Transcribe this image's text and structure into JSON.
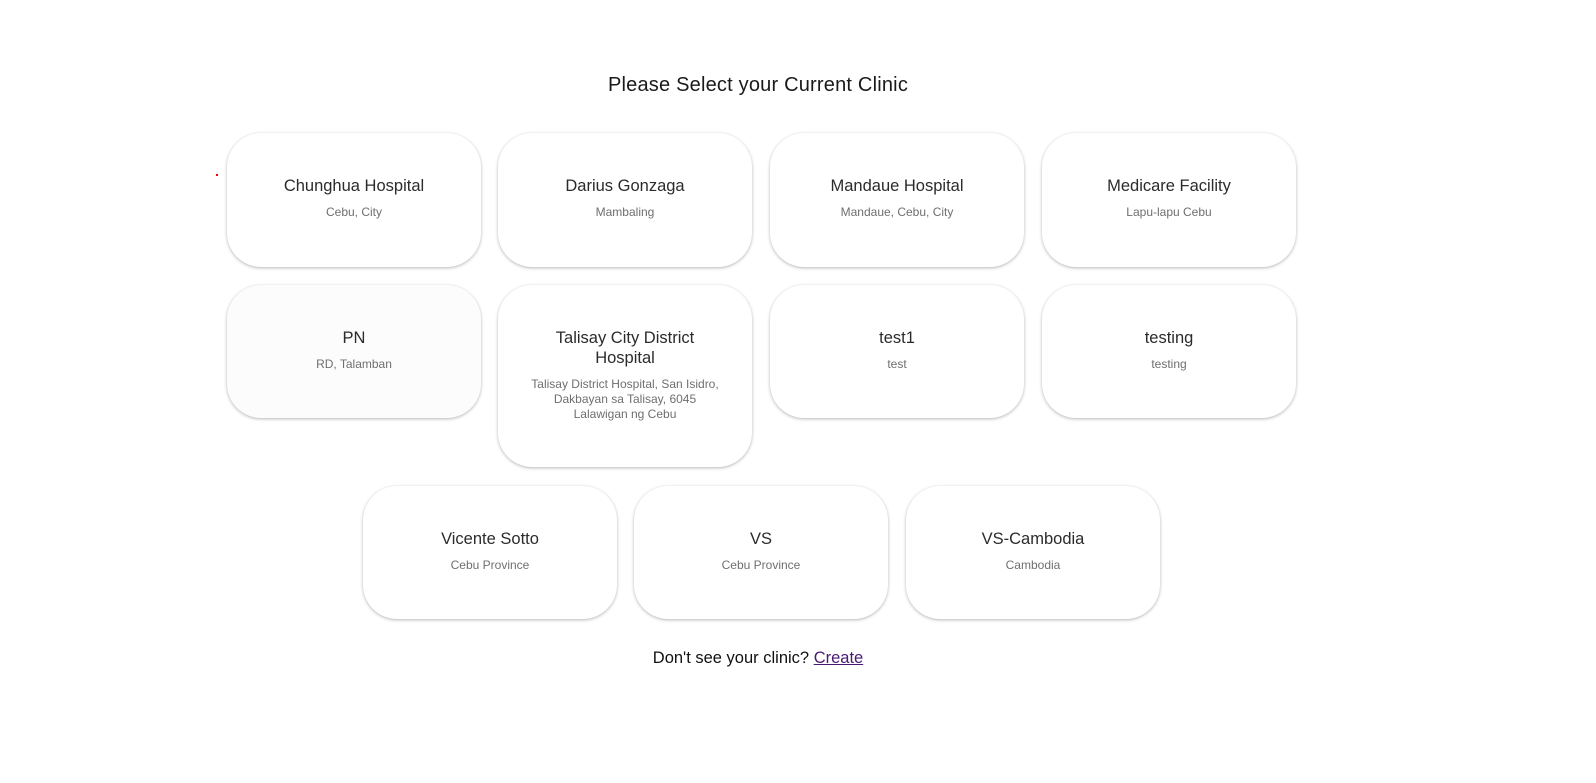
{
  "title": "Please Select your Current Clinic",
  "clinics": [
    {
      "name": "Chunghua Hospital",
      "address": "Cebu, City"
    },
    {
      "name": "Darius Gonzaga",
      "address": "Mambaling"
    },
    {
      "name": "Mandaue Hospital",
      "address": "Mandaue, Cebu, City"
    },
    {
      "name": "Medicare Facility",
      "address": "Lapu-lapu Cebu"
    },
    {
      "name": "PN",
      "address": "RD, Talamban"
    },
    {
      "name": "Talisay City District Hospital",
      "address": "Talisay District Hospital, San Isidro, Dakbayan sa Talisay, 6045 Lalawigan ng Cebu"
    },
    {
      "name": "test1",
      "address": "test"
    },
    {
      "name": "testing",
      "address": "testing"
    },
    {
      "name": "Vicente Sotto",
      "address": "Cebu Province"
    },
    {
      "name": "VS",
      "address": "Cebu Province"
    },
    {
      "name": "VS-Cambodia",
      "address": "Cambodia"
    }
  ],
  "footer": {
    "prompt": "Don't see your clinic?",
    "link_label": "Create"
  }
}
